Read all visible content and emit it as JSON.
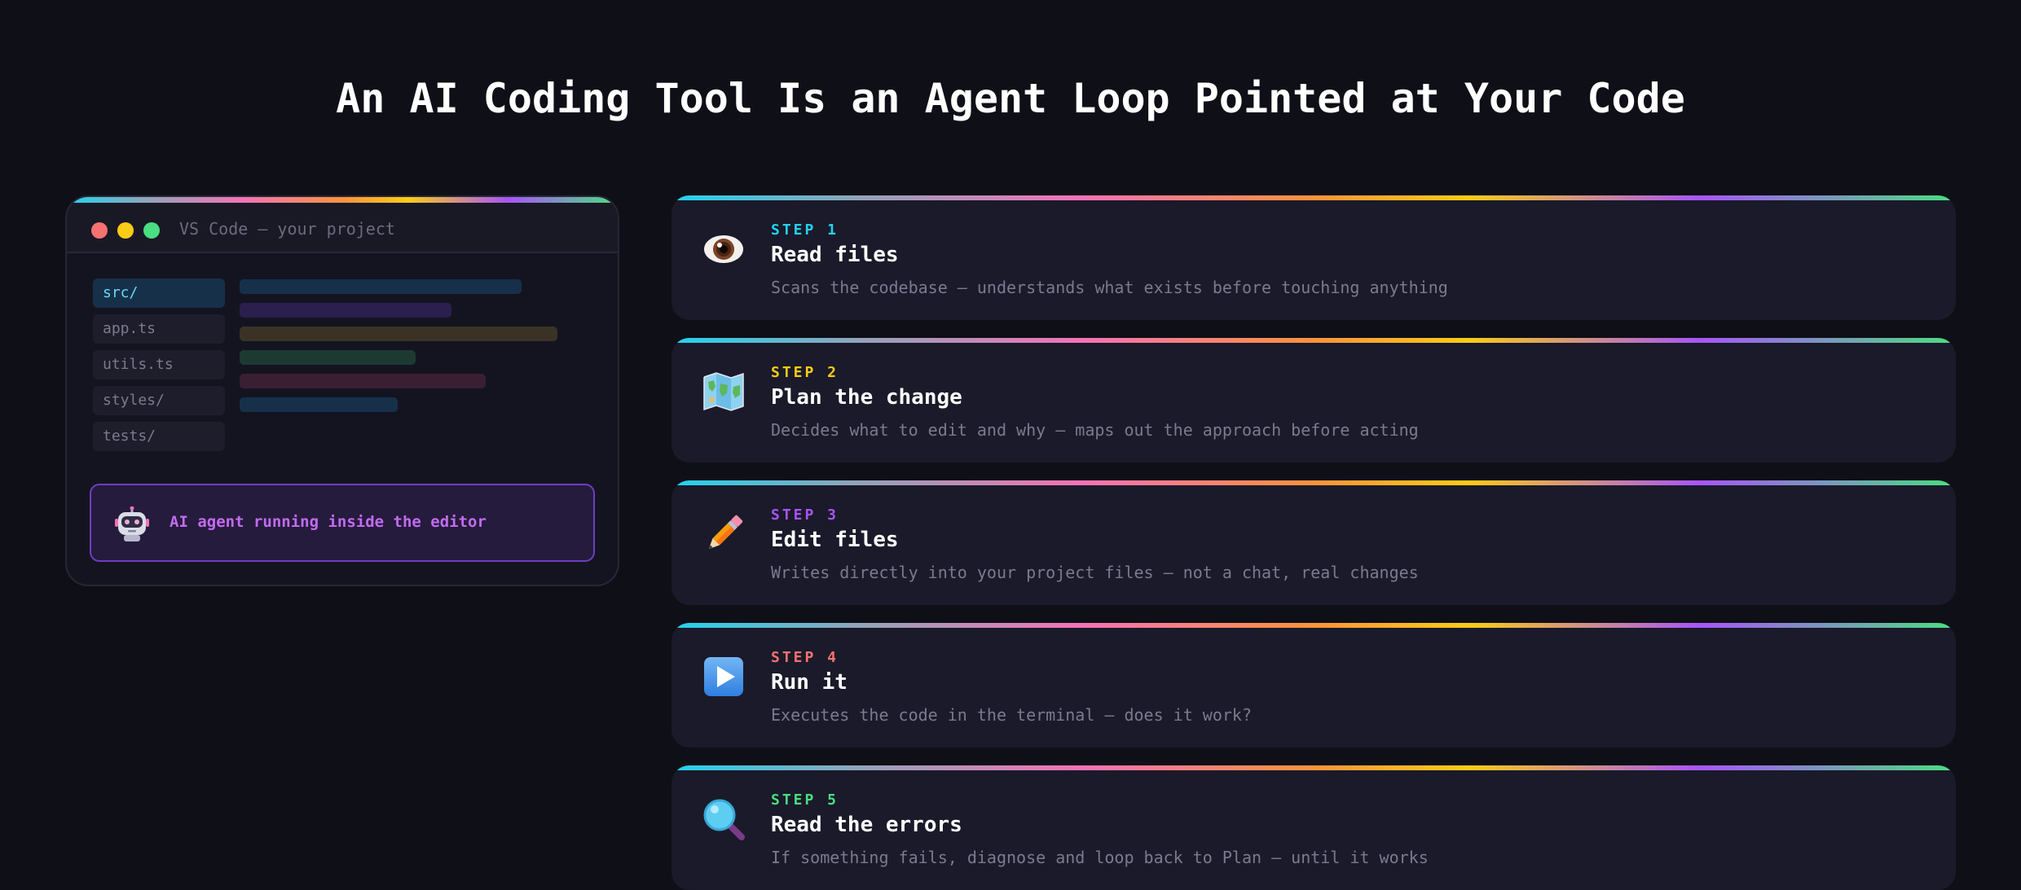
{
  "page": {
    "title": "An AI Coding Tool Is an Agent Loop Pointed at Your Code"
  },
  "editor": {
    "window_title": "VS Code — your project",
    "files": [
      "src/",
      "app.ts",
      "utils.ts",
      "styles/",
      "tests/"
    ],
    "active_file": "src/",
    "agent_label": "AI agent running inside the editor",
    "agent_icon": "robot-icon"
  },
  "steps": [
    {
      "number": "STEP 1",
      "name": "Read files",
      "description": "Scans the codebase — understands what exists before touching anything",
      "icon": "eye-icon",
      "color": "#22d3ee"
    },
    {
      "number": "STEP 2",
      "name": "Plan the change",
      "description": "Decides what to edit and why — maps out the approach before acting",
      "icon": "map-icon",
      "color": "#facc15"
    },
    {
      "number": "STEP 3",
      "name": "Edit files",
      "description": "Writes directly into your project files — not a chat, real changes",
      "icon": "pencil-icon",
      "color": "#a855f7"
    },
    {
      "number": "STEP 4",
      "name": "Run it",
      "description": "Executes the code in the terminal — does it work?",
      "icon": "play-icon",
      "color": "#f87171"
    },
    {
      "number": "STEP 5",
      "name": "Read the errors",
      "description": "If something fails, diagnose and loop back to Plan — until it works",
      "icon": "magnifier-icon",
      "color": "#4ade80"
    }
  ],
  "colors": {
    "background": "#0f0f17",
    "card": "#1a1a2a",
    "accent_purple": "#c26bf0"
  }
}
